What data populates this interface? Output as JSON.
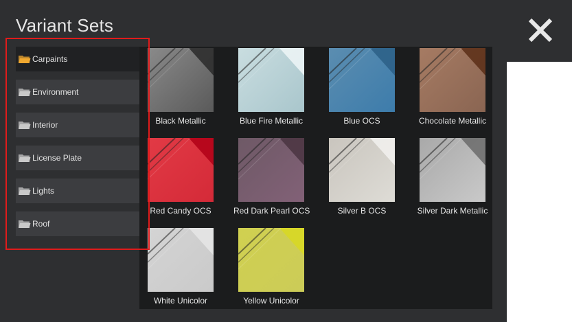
{
  "header": {
    "title": "Variant Sets"
  },
  "sidebar": {
    "items": [
      {
        "label": "Carpaints",
        "active": true
      },
      {
        "label": "Environment",
        "active": false
      },
      {
        "label": "Interior",
        "active": false
      },
      {
        "label": "License Plate",
        "active": false
      },
      {
        "label": "Lights",
        "active": false
      },
      {
        "label": "Roof",
        "active": false
      }
    ]
  },
  "gallery": {
    "items": [
      {
        "label": "Black Metallic",
        "color_top": "#8a8a8a",
        "color_bottom": "#5a5a5a",
        "accent": "#2a2a2a"
      },
      {
        "label": "Blue Fire Metallic",
        "color_top": "#c9dde0",
        "color_bottom": "#a9c6cc",
        "accent": "#eef6f7"
      },
      {
        "label": "Blue OCS",
        "color_top": "#5b8db0",
        "color_bottom": "#3d7cab",
        "accent": "#2b5f86"
      },
      {
        "label": "Chocolate Metallic",
        "color_top": "#a67b63",
        "color_bottom": "#8a6552",
        "accent": "#5a2e16"
      },
      {
        "label": "Red Candy OCS",
        "color_top": "#e23a45",
        "color_bottom": "#d42a38",
        "accent": "#b00016"
      },
      {
        "label": "Red Dark Pearl OCS",
        "color_top": "#6e5966",
        "color_bottom": "#826177",
        "accent": "#4a3441"
      },
      {
        "label": "Silver B OCS",
        "color_top": "#c9c5be",
        "color_bottom": "#dedcd6",
        "accent": "#f2f1ee"
      },
      {
        "label": "Silver Dark Metallic",
        "color_top": "#a9a9a9",
        "color_bottom": "#c9c9c9",
        "accent": "#6b6b6b"
      },
      {
        "label": "White Unicolor",
        "color_top": "#d4d4d4",
        "color_bottom": "#cacaca",
        "accent": "#e6e6e6"
      },
      {
        "label": "Yellow Unicolor",
        "color_top": "#d0d050",
        "color_bottom": "#cccc58",
        "accent": "#d8d822"
      }
    ]
  },
  "colors": {
    "background": "#2e2f31",
    "sidebar_item": "#3c3d40",
    "sidebar_item_active": "#202123",
    "gallery_bg": "#1b1c1d",
    "highlight_border": "#e01b1b",
    "folder_active": "#f0a830",
    "folder": "#c9c9c9"
  }
}
